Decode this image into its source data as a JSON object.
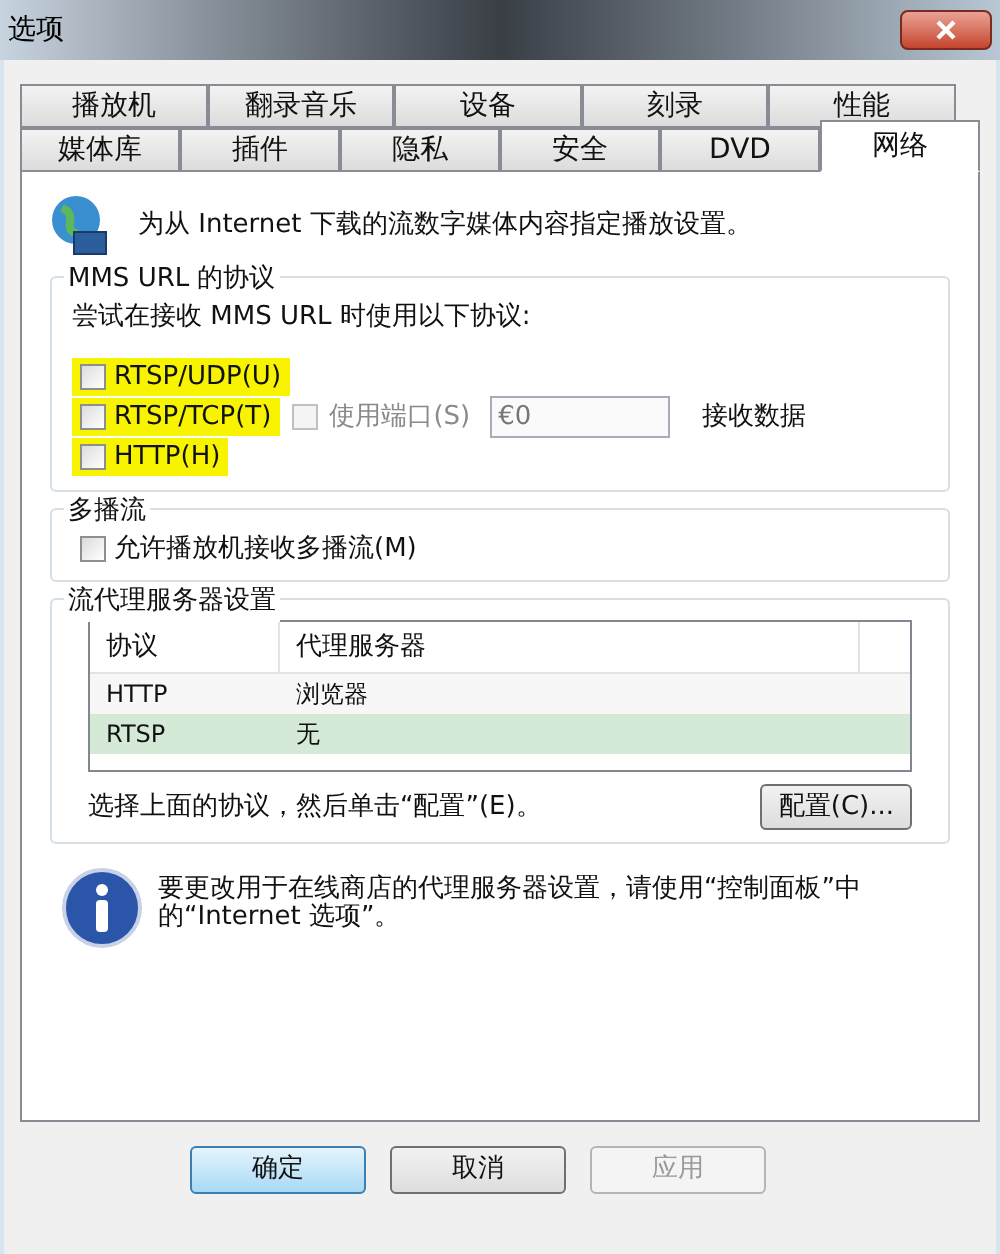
{
  "window": {
    "title": "选项"
  },
  "tabs": [
    [
      {
        "label": "播放机",
        "selected": false
      },
      {
        "label": "翻录音乐",
        "selected": false
      },
      {
        "label": "设备",
        "selected": false
      },
      {
        "label": "刻录",
        "selected": false
      },
      {
        "label": "性能",
        "selected": false
      }
    ],
    [
      {
        "label": "媒体库",
        "selected": false
      },
      {
        "label": "插件",
        "selected": false
      },
      {
        "label": "隐私",
        "selected": false
      },
      {
        "label": "安全",
        "selected": false
      },
      {
        "label": "DVD",
        "selected": false
      },
      {
        "label": "网络",
        "selected": true
      }
    ]
  ],
  "intro": "为从 Internet 下载的流数字媒体内容指定播放设置。",
  "protocols": {
    "title": "MMS URL 的协议",
    "prompt": "尝试在接收 MMS URL 时使用以下协议:",
    "items": [
      {
        "label": "RTSP/UDP(U)",
        "checked": false,
        "highlighted": true
      },
      {
        "label": "RTSP/TCP(T)",
        "checked": false,
        "highlighted": true
      },
      {
        "label": "HTTP(H)",
        "checked": false,
        "highlighted": true
      }
    ],
    "port": {
      "label": "使用端口(S)",
      "checked": false,
      "disabled": true,
      "value": "€0",
      "suffix": "接收数据"
    }
  },
  "multicast": {
    "title": "多播流",
    "label": "允许播放机接收多播流(M)",
    "checked": false
  },
  "proxy": {
    "title": "流代理服务器设置",
    "columns": [
      "协议",
      "代理服务器"
    ],
    "rows": [
      {
        "cells": [
          "HTTP",
          "浏览器"
        ],
        "selected": false
      },
      {
        "cells": [
          "RTSP",
          "无"
        ],
        "selected": true
      }
    ],
    "hint": "选择上面的协议，然后单击“配置”(E)。",
    "button": "配置(C)..."
  },
  "info": "要更改用于在线商店的代理服务器设置，请使用“控制面板”中的“Internet 选项”。",
  "buttons": [
    {
      "label": "确定",
      "kind": "default",
      "disabled": false
    },
    {
      "label": "取消",
      "kind": "normal",
      "disabled": false
    },
    {
      "label": "应用",
      "kind": "normal",
      "disabled": true
    }
  ]
}
